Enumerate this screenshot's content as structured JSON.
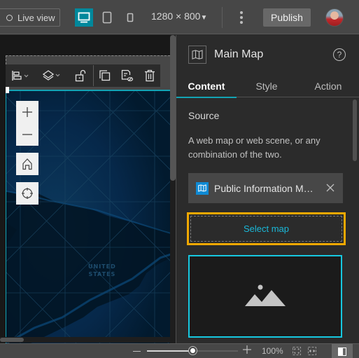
{
  "topbar": {
    "live_view_label": "Live view",
    "device_modes": [
      {
        "name": "desktop",
        "active": true
      },
      {
        "name": "tablet",
        "active": false
      },
      {
        "name": "phone",
        "active": false
      }
    ],
    "resolution": "1280 × 800",
    "resolution_caret": "▼",
    "publish_label": "Publish",
    "accent_color": "#00889c"
  },
  "canvas": {
    "toolbar": {
      "items": [
        "align-icon",
        "layers-icon",
        "unlock-icon",
        "duplicate-icon",
        "detach-icon",
        "delete-icon"
      ]
    },
    "map": {
      "label_line1": "UNITED",
      "label_line2": "STATES",
      "controls": {
        "zoom_in": "+",
        "zoom_out": "—"
      }
    }
  },
  "panel": {
    "title": "Main Map",
    "help": "?",
    "tabs": [
      {
        "label": "Content",
        "active": true
      },
      {
        "label": "Style",
        "active": false
      },
      {
        "label": "Action",
        "active": false
      }
    ],
    "source": {
      "label": "Source",
      "description": "A web map or web scene, or any combination of the two.",
      "selected_item": "Public Information M…",
      "select_map_label": "Select map"
    },
    "highlight_color": "#f0a800",
    "link_color": "#1ab8d8"
  },
  "bottombar": {
    "zoom_percent": "100%",
    "zoom_value": 100,
    "zoom_slider_fraction": 0.5
  }
}
